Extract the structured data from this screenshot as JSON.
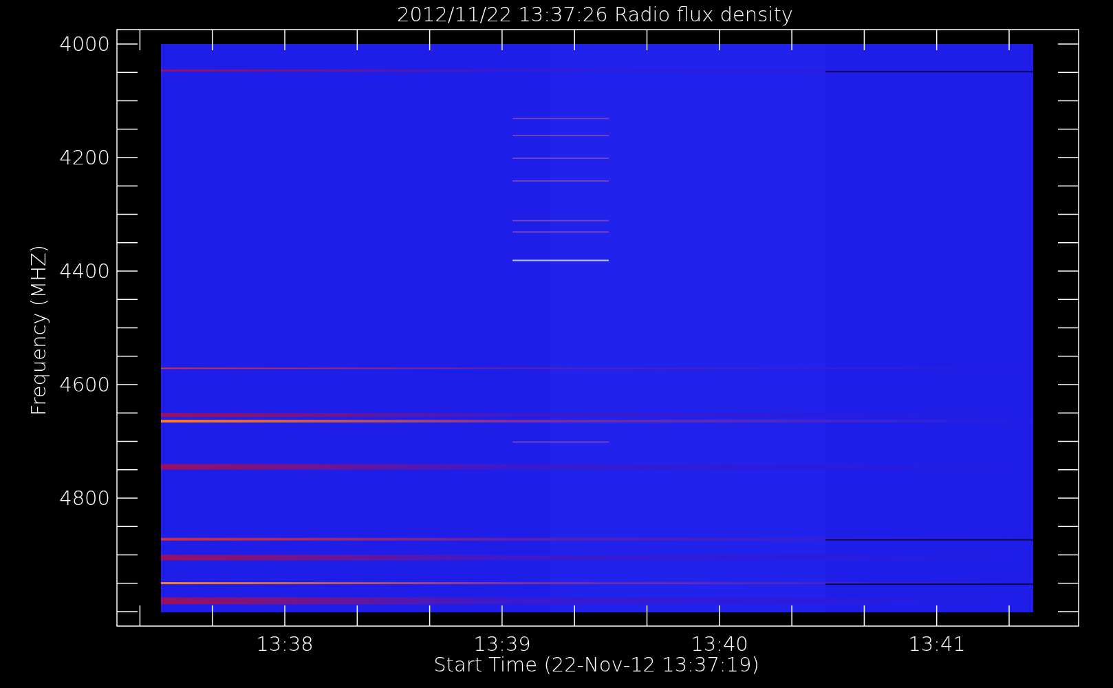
{
  "title": "2012/11/22 13:37:26 Radio flux density",
  "y_axis": {
    "label": "Frequency (MHZ)",
    "tick_labels": [
      "4000",
      "4200",
      "4400",
      "4600",
      "4800"
    ]
  },
  "x_axis": {
    "label": "Start Time (22-Nov-12 13:37:19)",
    "tick_labels": [
      "13:38",
      "13:39",
      "13:40",
      "13:41"
    ]
  }
}
